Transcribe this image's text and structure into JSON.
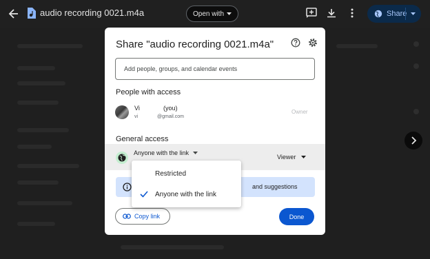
{
  "topbar": {
    "file_title": "audio recording 0021.m4a",
    "open_with_label": "Open with",
    "share_label": "Share",
    "icons": [
      "back-arrow-icon",
      "audio-file-icon",
      "add-comment-icon",
      "download-icon",
      "more-vert-icon",
      "chevron-down-icon"
    ]
  },
  "dialog": {
    "title": "Share \"audio recording 0021.m4a\"",
    "add_people_placeholder": "Add people, groups, and calendar events",
    "people_heading": "People with access",
    "user": {
      "name": "Vi",
      "you_tag": "(you)",
      "email_prefix": "vi",
      "email_domain": "@gmail.com",
      "role": "Owner"
    },
    "general_heading": "General access",
    "access_value": "Anyone with the link",
    "role_value": "Viewer",
    "info_text": "and suggestions",
    "copy_link_label": "Copy link",
    "done_label": "Done"
  },
  "dropdown": {
    "options": [
      {
        "label": "Restricted",
        "selected": false
      },
      {
        "label": "Anyone with the link",
        "selected": true
      }
    ]
  },
  "colors": {
    "accent": "#0b57d0",
    "banner": "#d3e3fd",
    "globe_bg": "#c4eed0",
    "dark_bg": "#1f1f1f"
  }
}
